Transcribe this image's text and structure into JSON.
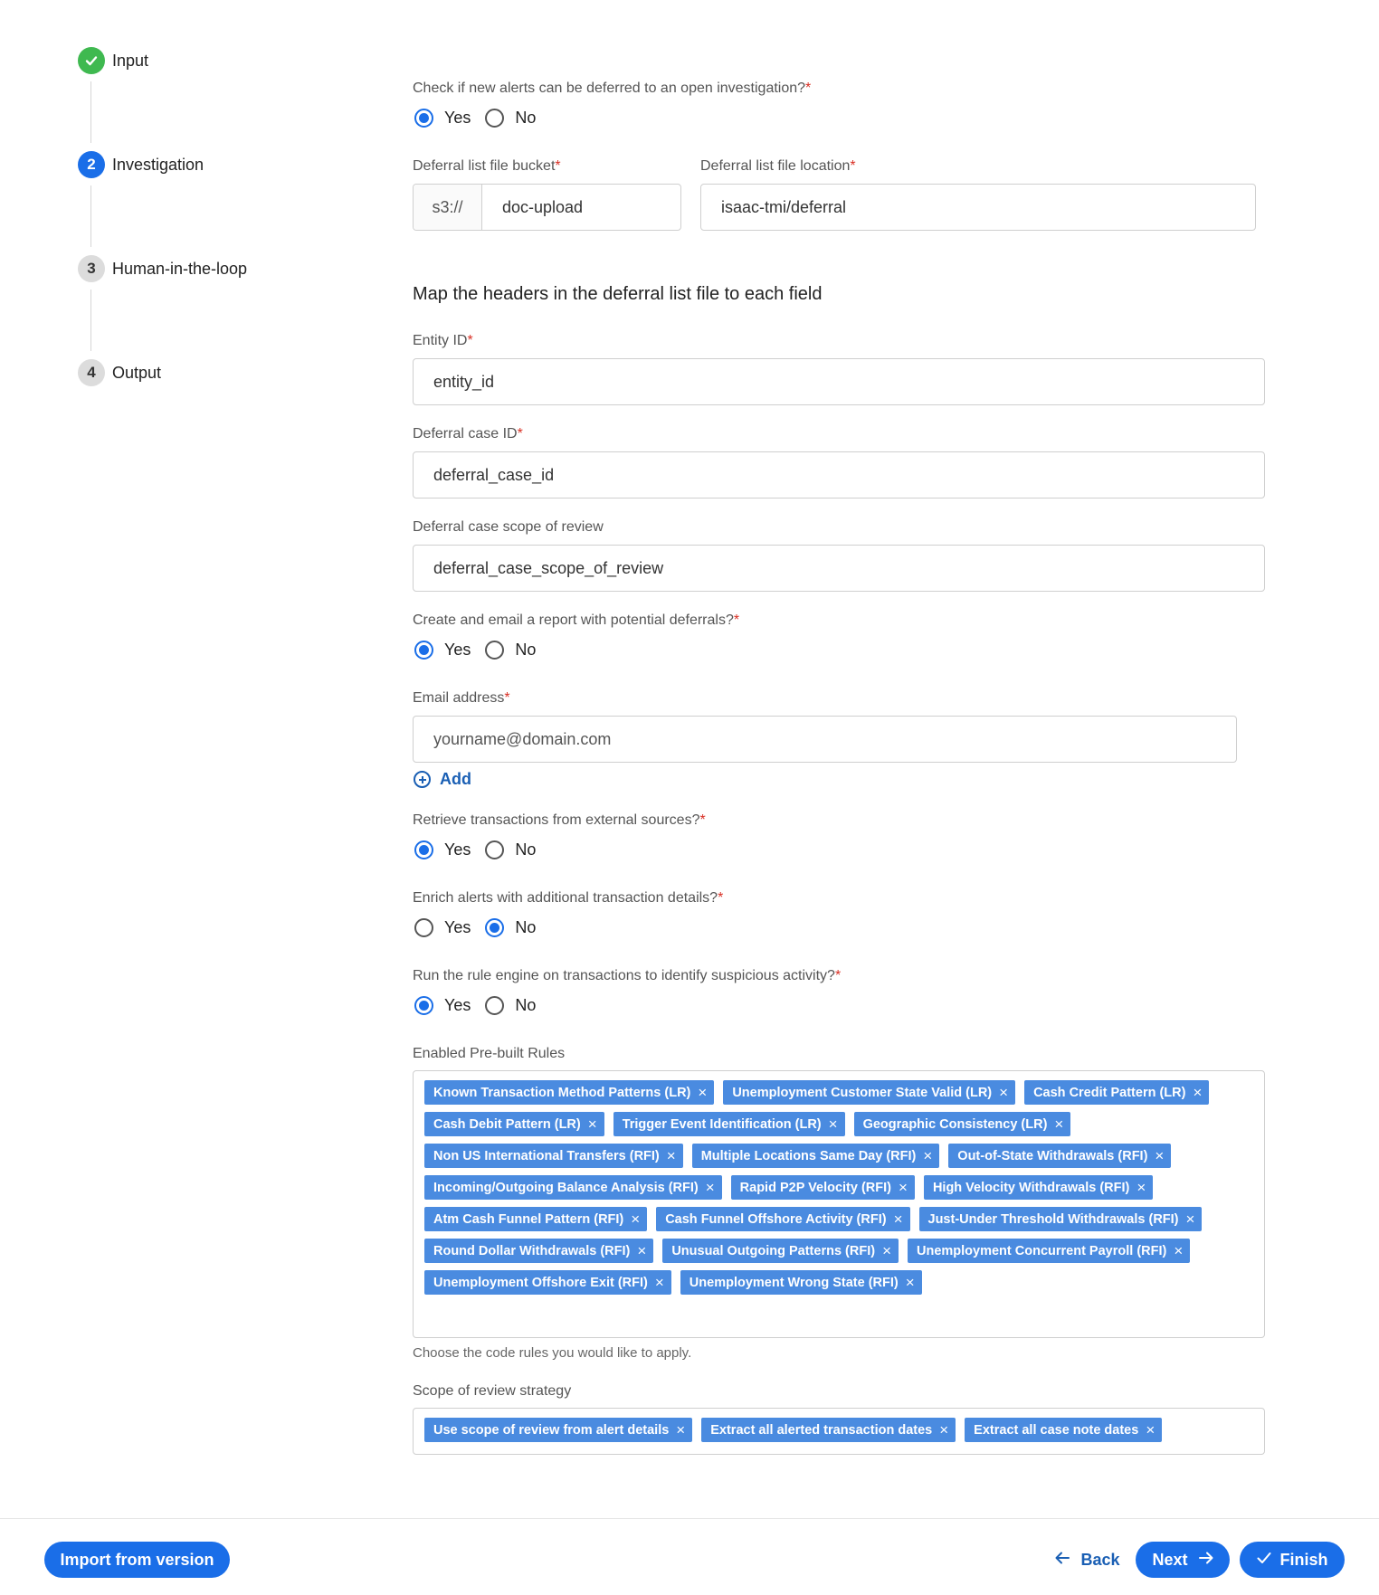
{
  "stepper": {
    "steps": [
      {
        "number": "",
        "label": "Input",
        "state": "done"
      },
      {
        "number": "2",
        "label": "Investigation",
        "state": "active"
      },
      {
        "number": "3",
        "label": "Human-in-the-loop",
        "state": "pending"
      },
      {
        "number": "4",
        "label": "Output",
        "state": "pending"
      }
    ]
  },
  "form": {
    "defer_question": {
      "label": "Check if new alerts can be deferred to an open investigation?",
      "required": "*",
      "yes": "Yes",
      "no": "No",
      "selected": "Yes"
    },
    "bucket": {
      "label": "Deferral list file bucket",
      "required": "*",
      "prefix": "s3://",
      "value": "doc-upload"
    },
    "location": {
      "label": "Deferral list file location",
      "required": "*",
      "value": "isaac-tmi/deferral"
    },
    "map_title": "Map the headers in the deferral list file to each field",
    "entity_id": {
      "label": "Entity ID",
      "required": "*",
      "value": "entity_id"
    },
    "deferral_case_id": {
      "label": "Deferral case ID",
      "required": "*",
      "value": "deferral_case_id"
    },
    "scope_of_review": {
      "label": "Deferral case scope of review",
      "value": "deferral_case_scope_of_review"
    },
    "report_question": {
      "label": "Create and email a report with potential deferrals?",
      "required": "*",
      "yes": "Yes",
      "no": "No",
      "selected": "Yes"
    },
    "email": {
      "label": "Email address",
      "required": "*",
      "placeholder": "yourname@domain.com"
    },
    "add_label": "Add",
    "external_question": {
      "label": "Retrieve transactions from external sources?",
      "required": "*",
      "yes": "Yes",
      "no": "No",
      "selected": "Yes"
    },
    "enrich_question": {
      "label": "Enrich alerts with additional transaction details?",
      "required": "*",
      "yes": "Yes",
      "no": "No",
      "selected": "No"
    },
    "rule_engine_question": {
      "label": "Run the rule engine on transactions to identify suspicious activity?",
      "required": "*",
      "yes": "Yes",
      "no": "No",
      "selected": "Yes"
    },
    "rules": {
      "label": "Enabled Pre-built Rules",
      "helper": "Choose the code rules you would like to apply.",
      "tags": [
        "Known Transaction Method Patterns (LR)",
        "Unemployment Customer State Valid (LR)",
        "Cash Credit Pattern (LR)",
        "Cash Debit Pattern (LR)",
        "Trigger Event Identification (LR)",
        "Geographic Consistency (LR)",
        "Non US International Transfers (RFI)",
        "Multiple Locations Same Day (RFI)",
        "Out-of-State Withdrawals (RFI)",
        "Incoming/Outgoing Balance Analysis (RFI)",
        "Rapid P2P Velocity (RFI)",
        "High Velocity Withdrawals (RFI)",
        "Atm Cash Funnel Pattern (RFI)",
        "Cash Funnel Offshore Activity (RFI)",
        "Just-Under Threshold Withdrawals (RFI)",
        "Round Dollar Withdrawals (RFI)",
        "Unusual Outgoing Patterns (RFI)",
        "Unemployment Concurrent Payroll (RFI)",
        "Unemployment Offshore Exit (RFI)",
        "Unemployment Wrong State (RFI)"
      ]
    },
    "strategy": {
      "label": "Scope of review strategy",
      "tags": [
        "Use scope of review from alert details",
        "Extract all alerted transaction dates",
        "Extract all case note dates"
      ]
    }
  },
  "footer": {
    "import_label": "Import from version",
    "back_label": "Back",
    "next_label": "Next",
    "finish_label": "Finish"
  },
  "colors": {
    "primary": "#1a6ee8",
    "tag": "#4a8be0",
    "success": "#3fb950",
    "required": "#d93025"
  },
  "icons": {
    "done_step": "check-icon",
    "back": "arrow-left-icon",
    "next": "arrow-right-icon",
    "finish": "check-icon",
    "add": "plus-circle-icon",
    "tag_remove": "close-icon"
  }
}
